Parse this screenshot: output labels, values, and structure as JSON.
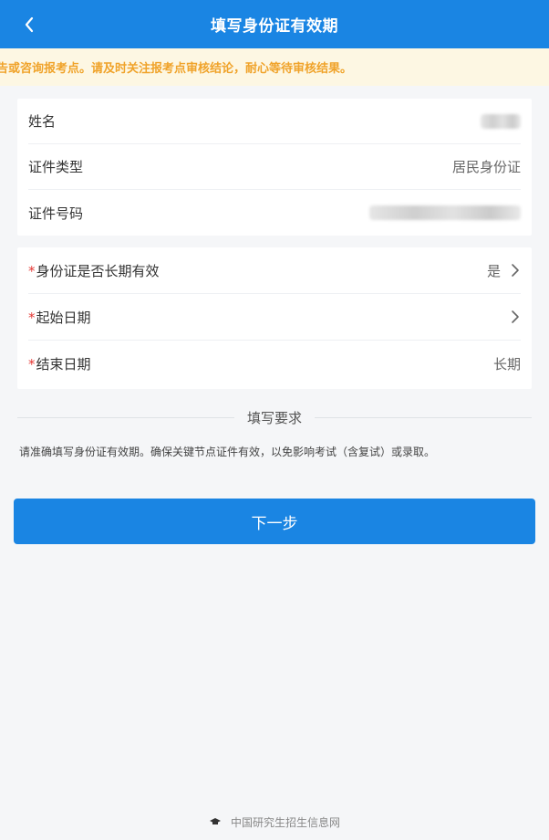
{
  "header": {
    "title": "填写身份证有效期",
    "back_icon": "chevron-left-icon"
  },
  "notice": {
    "text": "告或咨询报考点。请及时关注报考点审核结论，耐心等待审核结果。"
  },
  "identity_card": {
    "rows": [
      {
        "label": "姓名",
        "value": ""
      },
      {
        "label": "证件类型",
        "value": "居民身份证"
      },
      {
        "label": "证件号码",
        "value": ""
      }
    ]
  },
  "validity_card": {
    "rows": [
      {
        "required_mark": "*",
        "label": "身份证是否长期有效",
        "value": "是"
      },
      {
        "required_mark": "*",
        "label": "起始日期",
        "value": ""
      },
      {
        "required_mark": "*",
        "label": "结束日期",
        "value": "长期"
      }
    ]
  },
  "requirements": {
    "heading": "填写要求",
    "text": "请准确填写身份证有效期。确保关键节点证件有效，以免影响考试（含复试）或录取。"
  },
  "next_button": {
    "label": "下一步"
  },
  "footer": {
    "text": "中国研究生招生信息网",
    "logo_icon": "mortarboard-icon"
  },
  "colors": {
    "primary": "#1a85e3",
    "notice_bg": "#fdf7e3",
    "notice_text": "#f0a32a",
    "required": "#e53935"
  }
}
